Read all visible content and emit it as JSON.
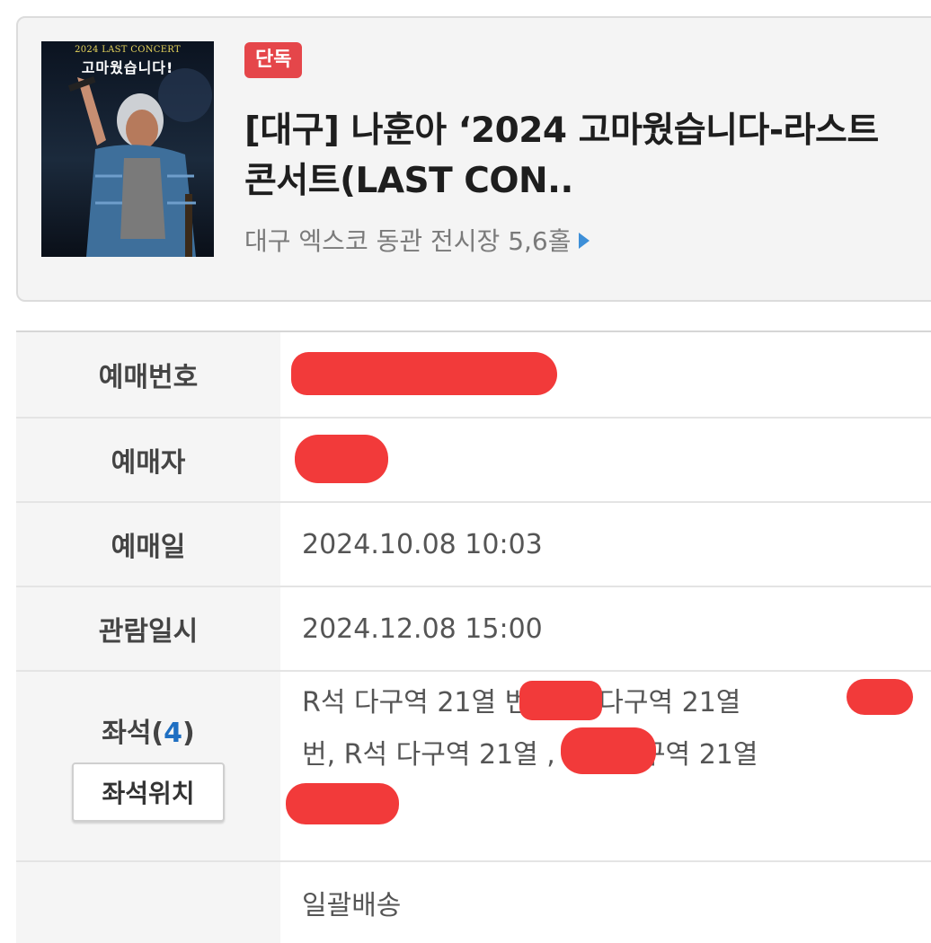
{
  "event": {
    "badge": "단독",
    "title": "[대구] 나훈아 ‘2024 고마웠습니다-라스트 콘서트(LAST CON..",
    "venue": "대구 엑스코 동관 전시장 5,6홀",
    "poster": {
      "line1": "2024 LAST CONCERT",
      "line2": "고마웠습니다!"
    }
  },
  "details": {
    "booking_number": {
      "label": "예매번호"
    },
    "booker": {
      "label": "예매자"
    },
    "booking_date": {
      "label": "예매일",
      "value": "2024.10.08 10:03"
    },
    "view_datetime": {
      "label": "관람일시",
      "value": "2024.12.08 15:00"
    },
    "seats": {
      "label": "좌석(",
      "count": "4",
      "label_close": ")",
      "button": "좌석위치",
      "line1": "R석 다구역 21열 번, R석 다구역 21열",
      "line2": "번, R석 다구역 21열 , R석 다구역 21열"
    },
    "delivery": {
      "value": "일괄배송"
    }
  },
  "colors": {
    "badge": "#e5464a",
    "redaction": "#f23a3a",
    "accent_blue": "#1f6fc2"
  }
}
